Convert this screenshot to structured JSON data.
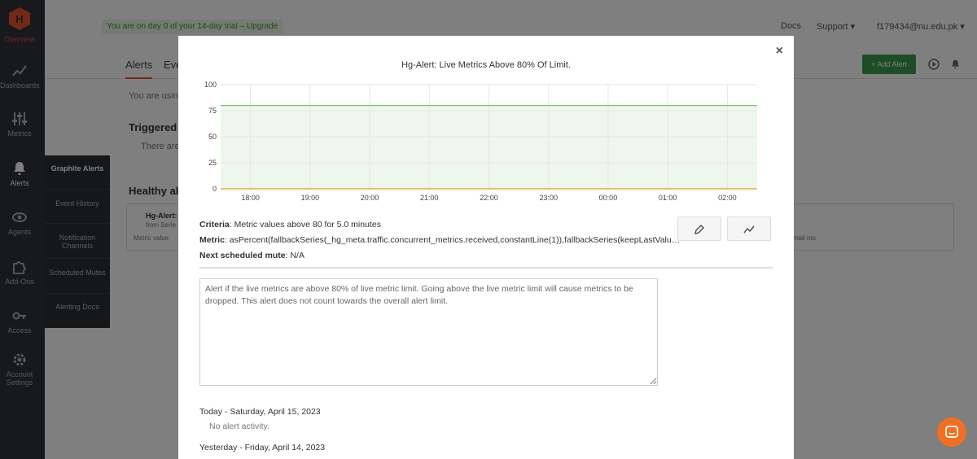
{
  "sidebar": {
    "logo_label": "Overview",
    "items": [
      {
        "label": "Dashboards",
        "icon": "chart-line-icon"
      },
      {
        "label": "Metrics",
        "icon": "sliders-icon"
      },
      {
        "label": "Alerts",
        "icon": "bell-icon"
      },
      {
        "label": "Agents",
        "icon": "eye-icon"
      },
      {
        "label": "Add-Ons",
        "icon": "puzzle-icon"
      },
      {
        "label": "Access",
        "icon": "key-icon"
      },
      {
        "label": "Account Settings",
        "icon": "gear-icon"
      }
    ],
    "flyout": [
      "Graphite Alerts",
      "Event History",
      "Notification Channels",
      "Scheduled Mutes",
      "Alerting Docs"
    ]
  },
  "topbar": {
    "trial": "You are on day 0 of your 14-day trial – Upgrade",
    "docs": "Docs",
    "support": "Support ▾",
    "user": "f179434@nu.edu.pk ▾"
  },
  "tabs": [
    "Alerts",
    "Eve"
  ],
  "add_alert": "Add Alert",
  "background": {
    "using": "You are using",
    "triggered": "Triggered al",
    "there_are": "There are",
    "healthy": "Healthy ale",
    "card_title": "Hg-Alert: L",
    "card_sub": "from Serie",
    "card_metric": "Metric value",
    "card_right": "mail mo"
  },
  "modal": {
    "title": "Hg-Alert: Live Metrics Above 80% Of Limit.",
    "close": "×",
    "criteria_label": "Criteria",
    "criteria_value": ": Metric values above 80 for 5.0 minutes",
    "metric_label": "Metric",
    "metric_value": ": asPercent(fallbackSeries(_hg_meta.traffic.concurrent_metrics.received,constantLine(1)),fallbackSeries(keepLastValue(_hg_m...",
    "mute_label": "Next scheduled mute",
    "mute_value": ": N/A",
    "description": "Alert if the live metrics are above 80% of live metric limit. Going above the live metric limit will cause metrics to be dropped. This alert does not count towards the overall alert limit.",
    "history": [
      {
        "day": "Today - Saturday, April 15, 2023",
        "note": "No alert activity."
      },
      {
        "day": "Yesterday - Friday, April 14, 2023",
        "note": ""
      }
    ]
  },
  "chart_data": {
    "type": "line",
    "title": "Hg-Alert: Live Metrics Above 80% Of Limit.",
    "xlabel": "",
    "ylabel": "",
    "x": [
      "18:00",
      "19:00",
      "20:00",
      "21:00",
      "22:00",
      "23:00",
      "00:00",
      "01:00",
      "02:00"
    ],
    "y_ticks": [
      0,
      25,
      50,
      75,
      100
    ],
    "ylim": [
      0,
      100
    ],
    "grid": true,
    "threshold": 80,
    "series": [
      {
        "values": [
          0,
          0,
          0,
          0,
          0,
          0,
          0,
          0,
          0
        ],
        "color": "#e0b030"
      }
    ],
    "threshold_color": "#7dc17a",
    "fill_color": "#eef7ec"
  },
  "colors": {
    "accent": "#e8522e",
    "add_button": "#3a9a4b",
    "chat": "#f26f21"
  }
}
